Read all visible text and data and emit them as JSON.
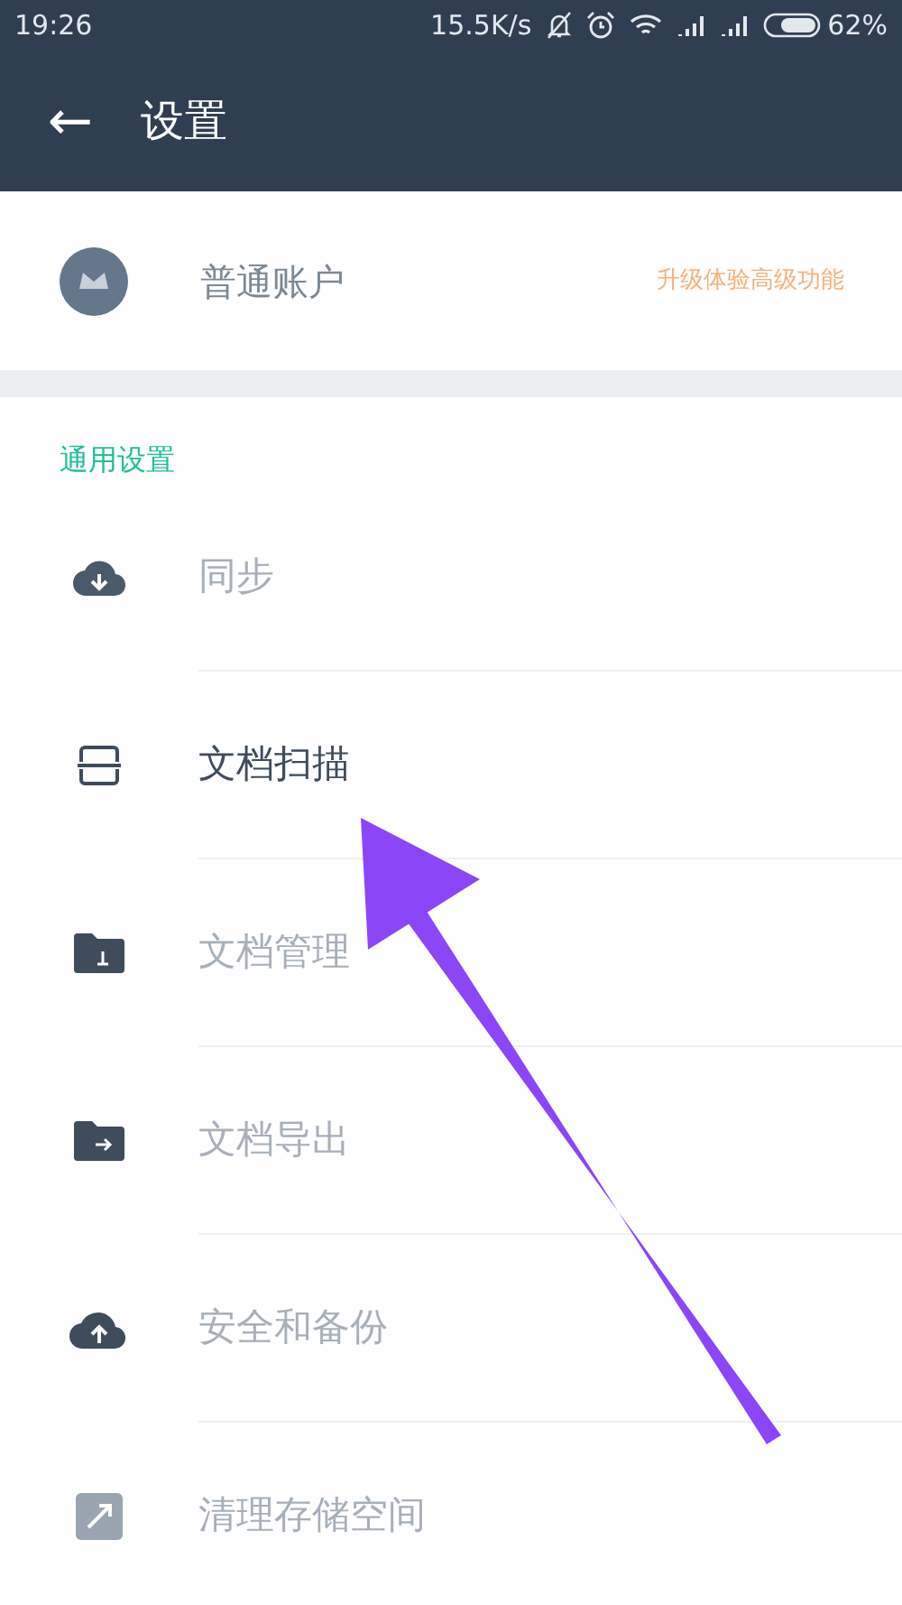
{
  "status_bar": {
    "time": "19:26",
    "speed": "15.5K/s",
    "battery": "62%"
  },
  "header": {
    "back": "←",
    "title": "设置"
  },
  "account": {
    "name": "普通账户",
    "upgrade": "升级体验高级功能"
  },
  "section": {
    "title": "通用设置",
    "items": [
      {
        "label": "同步",
        "highlighted": false
      },
      {
        "label": "文档扫描",
        "highlighted": true
      },
      {
        "label": "文档管理",
        "highlighted": false
      },
      {
        "label": "文档导出",
        "highlighted": false
      },
      {
        "label": "安全和备份",
        "highlighted": false
      },
      {
        "label": "清理存储空间",
        "highlighted": false
      }
    ]
  }
}
